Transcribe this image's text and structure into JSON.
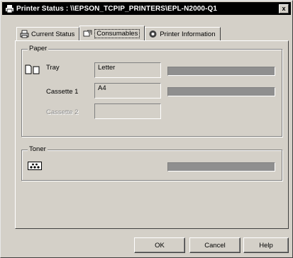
{
  "window": {
    "title": "Printer Status : \\\\EPSON_TCPIP_PRINTERS\\EPL-N2000-Q1",
    "close_glyph": "x"
  },
  "tabs": [
    {
      "label": "Current Status",
      "icon": "printer-icon",
      "active": false
    },
    {
      "label": "Consumables",
      "icon": "consumables-icon",
      "active": true
    },
    {
      "label": "Printer Information",
      "icon": "info-gear-icon",
      "active": false
    }
  ],
  "paper": {
    "group_label": "Paper",
    "rows": [
      {
        "label": "Tray",
        "value": "Letter",
        "level": 1.0,
        "enabled": true
      },
      {
        "label": "Cassette 1",
        "value": "A4",
        "level": 1.0,
        "enabled": true
      },
      {
        "label": "Cassette 2",
        "value": "",
        "level": null,
        "enabled": false
      }
    ]
  },
  "toner": {
    "group_label": "Toner",
    "level": 1.0,
    "icon": "toner-icon"
  },
  "buttons": {
    "ok": "OK",
    "cancel": "Cancel",
    "help": "Help"
  },
  "colors": {
    "titlebar": "#000000",
    "face": "#d4d0c8",
    "bar_fill": "#8f8f8f"
  }
}
